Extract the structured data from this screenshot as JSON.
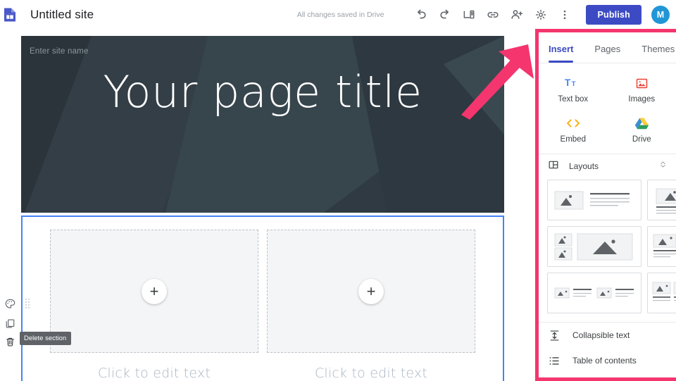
{
  "topbar": {
    "logo_icon": "google-sites-logo",
    "doc_title": "Untitled site",
    "save_status": "All changes saved in Drive",
    "icons": [
      {
        "name": "undo-icon",
        "label": "Undo"
      },
      {
        "name": "redo-icon",
        "label": "Redo"
      },
      {
        "name": "preview-icon",
        "label": "Preview"
      },
      {
        "name": "link-icon",
        "label": "Copy page link"
      },
      {
        "name": "share-icon",
        "label": "Share with others"
      },
      {
        "name": "settings-icon",
        "label": "Settings"
      },
      {
        "name": "more-icon",
        "label": "More"
      }
    ],
    "publish_label": "Publish",
    "avatar_initial": "M"
  },
  "left_rail": {
    "items": [
      {
        "name": "palette-icon",
        "label": "Section background"
      },
      {
        "name": "duplicate-icon",
        "label": "Duplicate section"
      },
      {
        "name": "trash-icon",
        "label": "Delete section"
      }
    ],
    "tooltip": "Delete section"
  },
  "canvas": {
    "banner": {
      "site_name_placeholder": "Enter site name",
      "page_title": "Your page title",
      "bg_color": "#2f3a42"
    },
    "section": {
      "selected": true,
      "selection_color": "#4285f4",
      "placeholders": [
        {
          "plus_label": "+",
          "caption": "Click to edit text"
        },
        {
          "plus_label": "+",
          "caption": "Click to edit text"
        }
      ]
    }
  },
  "right_panel": {
    "highlight_color": "#f4356e",
    "tabs": [
      {
        "label": "Insert",
        "active": true
      },
      {
        "label": "Pages",
        "active": false
      },
      {
        "label": "Themes",
        "active": false
      }
    ],
    "insert_items": [
      {
        "label": "Text box",
        "icon": "text-box-icon",
        "color": "#4285f4"
      },
      {
        "label": "Images",
        "icon": "images-icon",
        "color": "#ea4335"
      },
      {
        "label": "Embed",
        "icon": "embed-icon",
        "color": "#f9ab00"
      },
      {
        "label": "Drive",
        "icon": "drive-icon",
        "color": "#0f9d58"
      }
    ],
    "layouts": {
      "icon": "layouts-grid-icon",
      "label": "Layouts",
      "collapse_icon": "collapse-chevron-icon",
      "options": [
        {
          "name": "layout-image-left-text-right"
        },
        {
          "name": "layout-two-image-two-text"
        },
        {
          "name": "layout-two-small-one-large-image"
        },
        {
          "name": "layout-three-image-three-text"
        },
        {
          "name": "layout-two-small-image-text-pairs"
        },
        {
          "name": "layout-four-image-four-text"
        }
      ]
    },
    "list_items": [
      {
        "label": "Collapsible text",
        "icon": "collapsible-text-icon"
      },
      {
        "label": "Table of contents",
        "icon": "table-of-contents-icon"
      }
    ]
  },
  "annotation": {
    "arrow_color": "#f4356e",
    "name": "pointer-arrow"
  }
}
